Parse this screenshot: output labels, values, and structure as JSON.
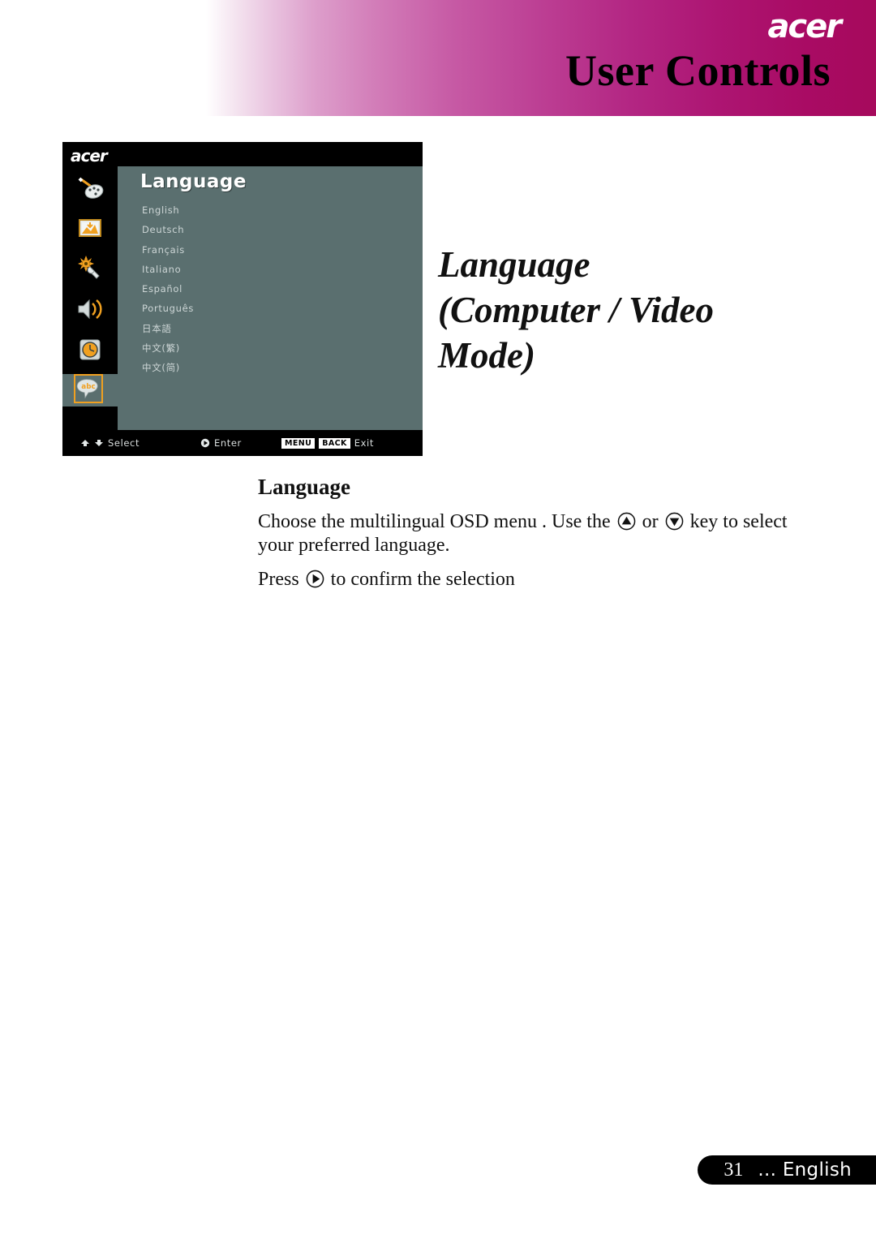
{
  "header": {
    "brand": "acer",
    "title": "User Controls",
    "gradient_start": "#ffffff",
    "gradient_end": "#a60a5c"
  },
  "osd": {
    "brand": "acer",
    "menu_title": "Language",
    "accent_color": "#f0a020",
    "panel_bg": "#5a6f6f",
    "sidebar": [
      {
        "name": "palette-icon",
        "label": "Color"
      },
      {
        "name": "image-icon",
        "label": "Image"
      },
      {
        "name": "settings-icon",
        "label": "Setting"
      },
      {
        "name": "speaker-icon",
        "label": "Audio"
      },
      {
        "name": "timer-icon",
        "label": "Timer"
      },
      {
        "name": "abc-bubble-icon",
        "label": "Language",
        "selected": true
      }
    ],
    "languages": [
      "English",
      "Deutsch",
      "Français",
      "Italiano",
      "Español",
      "Português",
      "日本語",
      "中文(繁)",
      "中文(简)"
    ],
    "footer": {
      "select_label": "Select",
      "enter_label": "Enter",
      "exit_label": "Exit",
      "menu_key": "MENU",
      "back_key": "BACK"
    }
  },
  "section": {
    "title_line1": "Language",
    "title_line2": "(Computer / Video",
    "title_line3": "Mode)"
  },
  "body": {
    "heading": "Language",
    "para1_part1": "Choose the multilingual OSD menu . Use the",
    "para1_part2": "or",
    "para1_part3": "key to select your preferred language.",
    "para2_part1": "Press",
    "para2_part2": "to confirm the selection"
  },
  "page_footer": {
    "number": "31",
    "label": "... English"
  }
}
